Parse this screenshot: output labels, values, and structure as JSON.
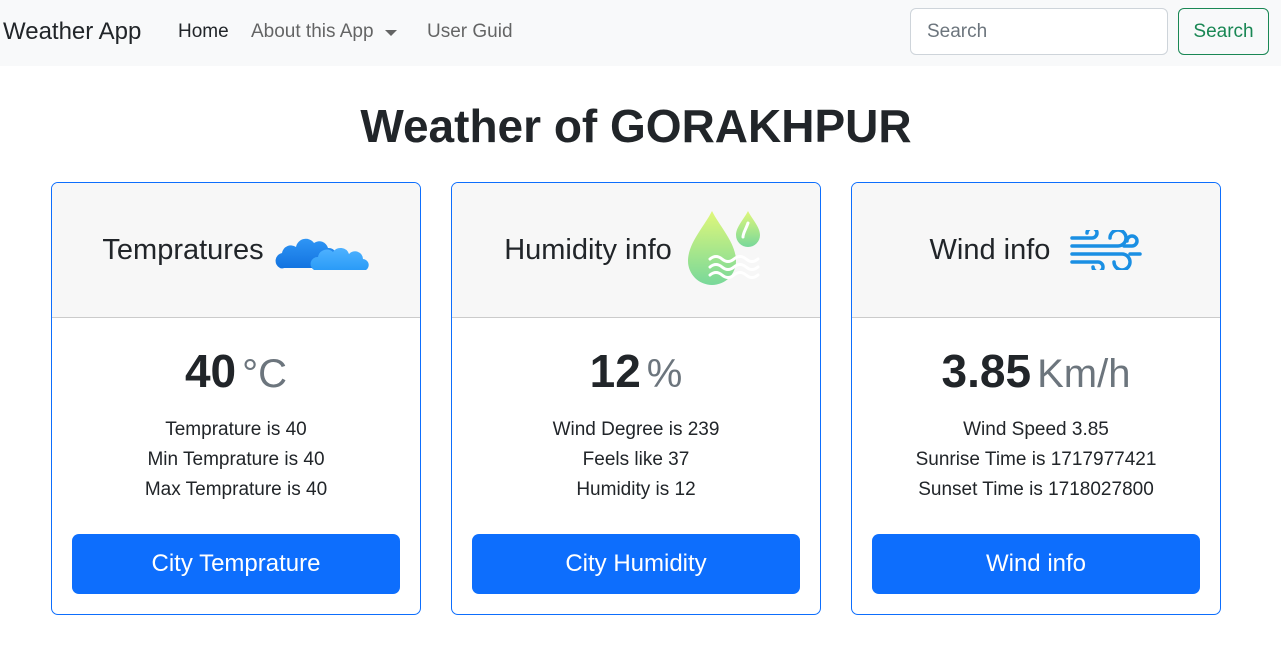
{
  "navbar": {
    "brand": "Weather App",
    "links": [
      {
        "label": "Home"
      },
      {
        "label": "About this App"
      },
      {
        "label": "User Guid"
      }
    ],
    "search": {
      "placeholder": "Search",
      "value": "",
      "button_label": "Search"
    }
  },
  "title": "Weather of GORAKHPUR",
  "cards": [
    {
      "header": "Tempratures",
      "icon": "cloud-icon",
      "value": "40",
      "unit": "°C",
      "details": [
        "Temprature is 40",
        "Min Temprature is 40",
        "Max Temprature is 40"
      ],
      "button_label": "City Temprature"
    },
    {
      "header": "Humidity info",
      "icon": "water-drops-icon",
      "value": "12",
      "unit": "%",
      "details": [
        "Wind Degree is 239",
        "Feels like 37",
        "Humidity is 12"
      ],
      "button_label": "City Humidity"
    },
    {
      "header": "Wind info",
      "icon": "wind-icon",
      "value": "3.85",
      "unit": "Km/h",
      "details": [
        "Wind Speed 3.85",
        "Sunrise Time is 1717977421",
        "Sunset Time is 1718027800"
      ],
      "button_label": "Wind info"
    }
  ],
  "colors": {
    "primary": "#0d6efd",
    "success": "#198754",
    "navbar_bg": "#f8f9fa"
  }
}
